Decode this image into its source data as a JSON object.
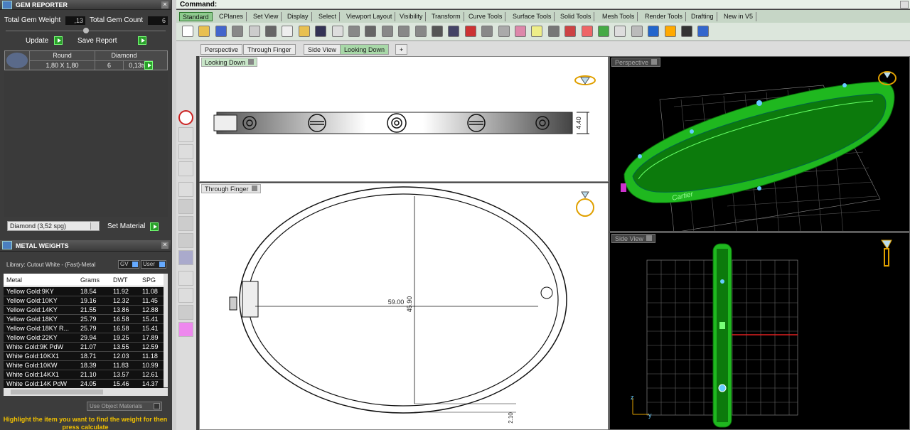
{
  "gem_reporter": {
    "title": "GEM REPORTER",
    "total_weight_label": "Total Gem Weight",
    "total_weight_value": ",13",
    "total_count_label": "Total Gem Count",
    "total_count_value": "6",
    "update_label": "Update",
    "save_report_label": "Save Report",
    "gem_row": {
      "shape": "Round",
      "material": "Diamond",
      "size": "1,80 X 1,80",
      "count": "6",
      "weight": "0,13tw"
    },
    "material_select": "Diamond    (3,52 spg)",
    "set_material_label": "Set Material"
  },
  "metal_weights": {
    "title": "METAL WEIGHTS",
    "library": "Library: Cutout White - (Fast)-Metal",
    "gv_label": "GV",
    "user_label": "User",
    "columns": [
      "Metal",
      "Grams",
      "DWT",
      "SPG"
    ],
    "rows": [
      [
        "Yellow Gold:9KY",
        "18.54",
        "11.92",
        "11.08"
      ],
      [
        "Yellow Gold:10KY",
        "19.16",
        "12.32",
        "11.45"
      ],
      [
        "Yellow Gold:14KY",
        "21.55",
        "13.86",
        "12.88"
      ],
      [
        "Yellow Gold:18KY",
        "25.79",
        "16.58",
        "15.41"
      ],
      [
        "Yellow Gold:18KY R...",
        "25.79",
        "16.58",
        "15.41"
      ],
      [
        "Yellow Gold:22KY",
        "29.94",
        "19.25",
        "17.89"
      ],
      [
        "White Gold:9K PdW",
        "21.07",
        "13.55",
        "12.59"
      ],
      [
        "White Gold:10KX1",
        "18.71",
        "12.03",
        "11.18"
      ],
      [
        "White Gold:10KW",
        "18.39",
        "11.83",
        "10.99"
      ],
      [
        "White Gold:14KX1",
        "21.10",
        "13.57",
        "12.61"
      ],
      [
        "White Gold:14K PdW",
        "24.05",
        "15.46",
        "14.37"
      ]
    ],
    "use_object_materials": "Use Object Materials",
    "hint": "Highlight the item you want to find the weight for then press calculate"
  },
  "command_label": "Command:",
  "toolbar_tabs": [
    "Standard",
    "CPlanes",
    "Set View",
    "Display",
    "Select",
    "Viewport Layout",
    "Visibility",
    "Transform",
    "Curve Tools",
    "Surface Tools",
    "Solid Tools",
    "Mesh Tools",
    "Render Tools",
    "Drafting",
    "New in V5"
  ],
  "view_tabs": [
    "Perspective",
    "Through Finger",
    "Side View",
    "Looking Down"
  ],
  "add_tab_label": "+",
  "viewports": {
    "looking_down": {
      "label": "Looking Down",
      "dimension": "4.40"
    },
    "through_finger": {
      "label": "Through Finger",
      "width_dim": "59.00",
      "height_dim": "45.90",
      "thickness_dim": "2.10"
    },
    "perspective": {
      "label": "Perspective",
      "engraving": "Cartier"
    },
    "side_view": {
      "label": "Side View",
      "axis_z": "z",
      "axis_y": "y"
    }
  },
  "icons": [
    "info-icon",
    "point-icon",
    "circle-icon",
    "node-icon",
    "axes-icon",
    "box-icon",
    "box-icon",
    "box-icon",
    "box-icon",
    "curve-icon",
    "surface-icon",
    "mesh-icon",
    "gear-icon"
  ],
  "colors": {
    "accent": "#2aa02a",
    "viewport_green": "#1fb81f",
    "hint": "#f0c000"
  }
}
